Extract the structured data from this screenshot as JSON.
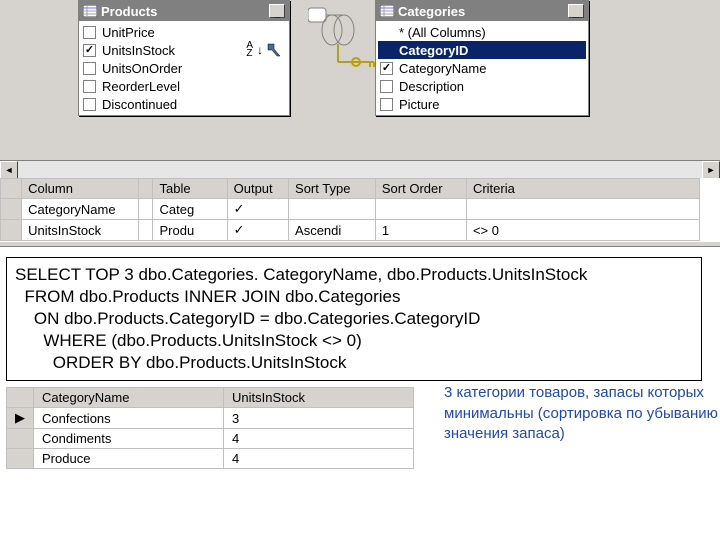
{
  "tables": {
    "products": {
      "title": "Products",
      "fields": [
        {
          "name": "UnitPrice",
          "checked": false,
          "sort": false
        },
        {
          "name": "UnitsInStock",
          "checked": true,
          "sort": true
        },
        {
          "name": "UnitsOnOrder",
          "checked": false,
          "sort": false
        },
        {
          "name": "ReorderLevel",
          "checked": false,
          "sort": false
        },
        {
          "name": "Discontinued",
          "checked": false,
          "sort": false
        }
      ]
    },
    "categories": {
      "title": "Categories",
      "fields": [
        {
          "name": "* (All Columns)",
          "checked": false,
          "no_checkbox": true
        },
        {
          "name": "CategoryID",
          "checked": false,
          "selected": true
        },
        {
          "name": "CategoryName",
          "checked": true
        },
        {
          "name": "Description",
          "checked": false
        },
        {
          "name": "Picture",
          "checked": false
        }
      ]
    }
  },
  "criteria_grid": {
    "headers": [
      "Column",
      "",
      "Table",
      "Output",
      "Sort Type",
      "Sort Order",
      "Criteria"
    ],
    "rows": [
      {
        "column": "CategoryName",
        "alias": "",
        "table": "Categ",
        "output": "✓",
        "sort_type": "",
        "sort_order": "",
        "criteria": ""
      },
      {
        "column": "UnitsInStock",
        "alias": "",
        "table": "Produ",
        "output": "✓",
        "sort_type": "Ascendi",
        "sort_order": "1",
        "criteria": "<> 0"
      }
    ]
  },
  "sql": "SELECT TOP 3 dbo.Categories. CategoryName, dbo.Products.UnitsInStock\n  FROM dbo.Products INNER JOIN dbo.Categories\n    ON dbo.Products.CategoryID = dbo.Categories.CategoryID\n      WHERE (dbo.Products.UnitsInStock <> 0)\n        ORDER BY dbo.Products.UnitsInStock",
  "results": {
    "headers": [
      "CategoryName",
      "UnitsInStock"
    ],
    "rows": [
      {
        "CategoryName": "Confections",
        "UnitsInStock": "3"
      },
      {
        "CategoryName": "Condiments",
        "UnitsInStock": "4"
      },
      {
        "CategoryName": "Produce",
        "UnitsInStock": "4"
      }
    ]
  },
  "note": "3 категории товаров,  запасы которых минимальны (сортировка по убыванию значения запаса)",
  "sort_badge": "A Z",
  "checkmark": "✓",
  "min_glyph": "_",
  "tri": {
    "left": "◄",
    "right": "►",
    "row": "▶"
  }
}
